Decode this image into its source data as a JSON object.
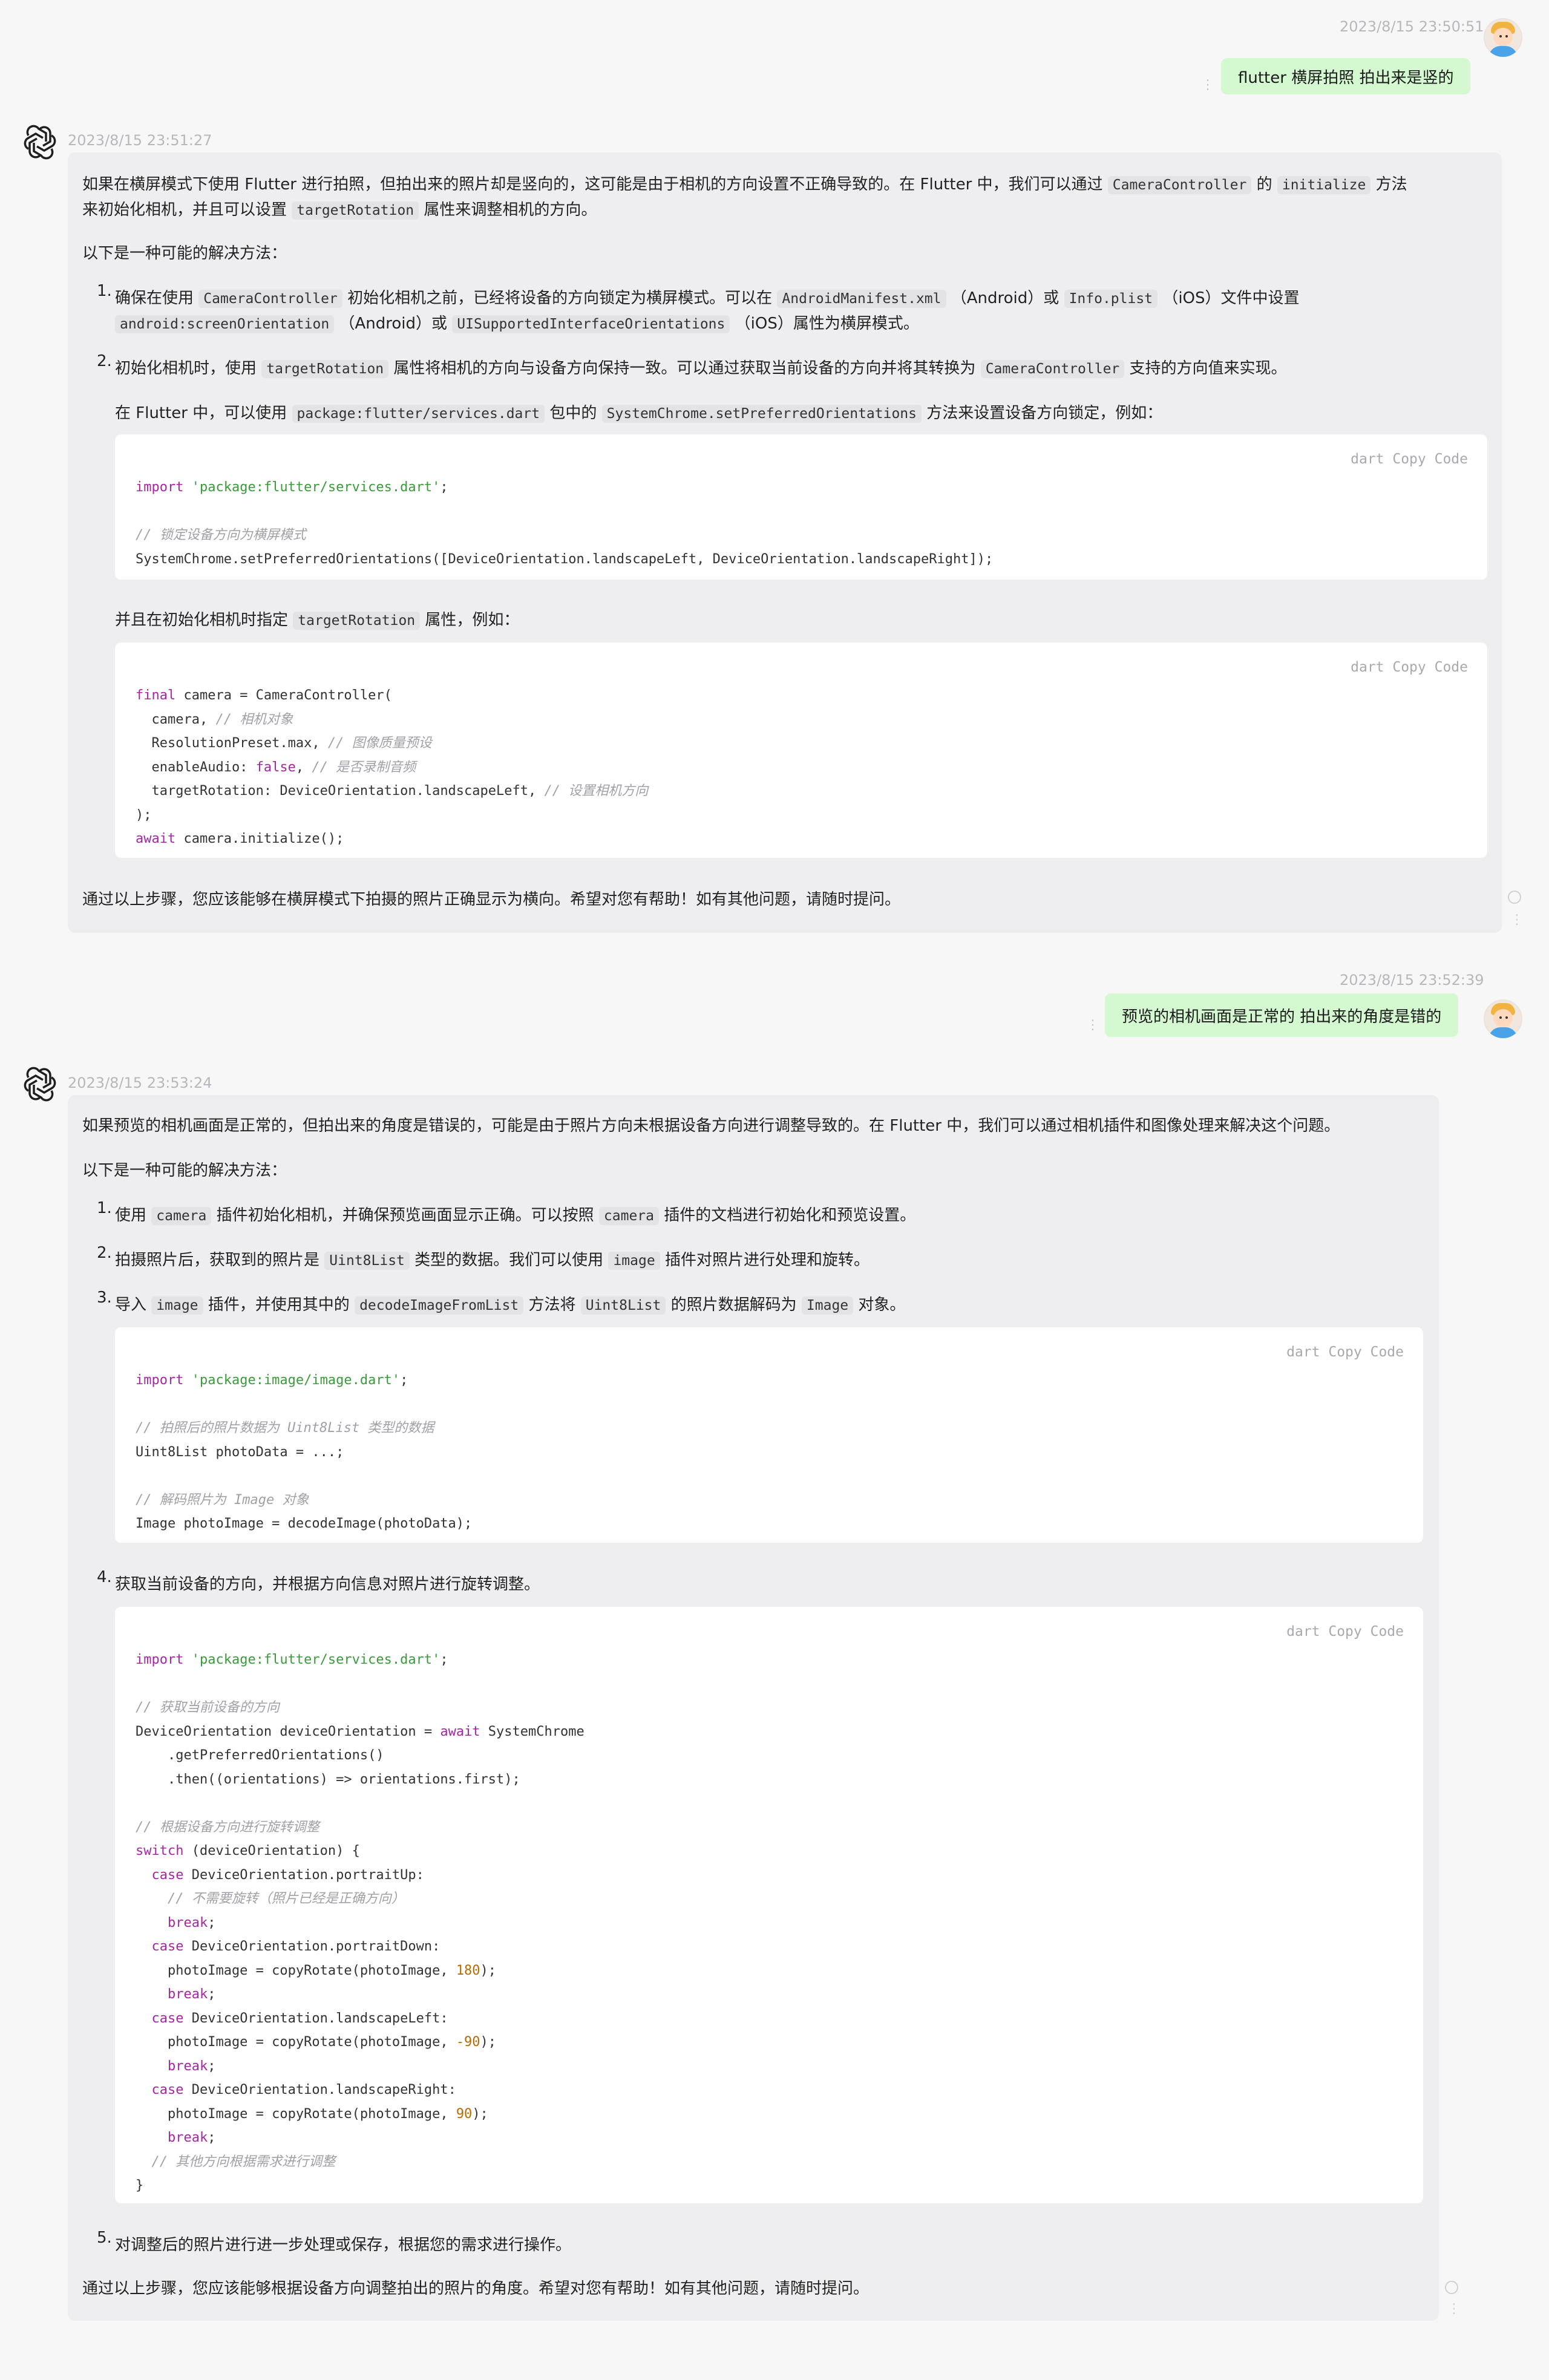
{
  "messages": {
    "m1": {
      "time": "2023/8/15 23:50:51",
      "text": "flutter 横屏拍照 拍出来是竖的"
    },
    "m2": {
      "time": "2023/8/15 23:51:27",
      "intro_a": "如果在横屏模式下使用 Flutter 进行拍照，但拍出来的照片却是竖向的，这可能是由于相机的方向设置不正确导致的。在 Flutter 中，我们可以通过",
      "intro_code1": "CameraController",
      "intro_b": "的",
      "intro_code2": "initialize",
      "intro_c": "方法",
      "intro2_a": "来初始化相机，并且可以设置",
      "intro2_code": "targetRotation",
      "intro2_b": "属性来调整相机的方向。",
      "solutions": "以下是一种可能的解决方法：",
      "s1_a": "确保在使用",
      "s1_code1": "CameraController",
      "s1_b": "初始化相机之前，已经将设备的方向锁定为横屏模式。可以在",
      "s1_code2": "AndroidManifest.xml",
      "s1_c": "（Android）或",
      "s1_code3": "Info.plist",
      "s1_d": "（iOS）文件中设置",
      "s1l2_code1": "android:screenOrientation",
      "s1l2_a": "（Android）或",
      "s1l2_code2": "UISupportedInterfaceOrientations",
      "s1l2_b": "（iOS）属性为横屏模式。",
      "s2_a": "初始化相机时，使用",
      "s2_code1": "targetRotation",
      "s2_b": "属性将相机的方向与设备方向保持一致。可以通过获取当前设备的方向并将其转换为",
      "s2_code2": "CameraController",
      "s2_c": "支持的方向值来实现。",
      "s2p_a": "在 Flutter 中，可以使用",
      "s2p_code1": "package:flutter/services.dart",
      "s2p_b": "包中的",
      "s2p_code2": "SystemChrome.setPreferredOrientations",
      "s2p_c": "方法来设置设备方向锁定，例如：",
      "code_header": "dart Copy Code",
      "s2q_a": "并且在初始化相机时指定",
      "s2q_code": "targetRotation",
      "s2q_b": "属性，例如：",
      "outro": "通过以上步骤，您应该能够在横屏模式下拍摄的照片正确显示为横向。希望对您有帮助！如有其他问题，请随时提问。"
    },
    "m3": {
      "time": "2023/8/15 23:52:39",
      "text": "预览的相机画面是正常的 拍出来的角度是错的"
    },
    "m4": {
      "time": "2023/8/15 23:53:24",
      "intro": "如果预览的相机画面是正常的，但拍出来的角度是错误的，可能是由于照片方向未根据设备方向进行调整导致的。在 Flutter 中，我们可以通过相机插件和图像处理来解决这个问题。",
      "solutions": "以下是一种可能的解决方法：",
      "s1_a": "使用",
      "s1_code1": "camera",
      "s1_b": "插件初始化相机，并确保预览画面显示正确。可以按照",
      "s1_code2": "camera",
      "s1_c": "插件的文档进行初始化和预览设置。",
      "s2_a": "拍摄照片后，获取到的照片是",
      "s2_code1": "Uint8List",
      "s2_b": "类型的数据。我们可以使用",
      "s2_code2": "image",
      "s2_c": "插件对照片进行处理和旋转。",
      "s3_a": "导入",
      "s3_code1": "image",
      "s3_b": "插件，并使用其中的",
      "s3_code2": "decodeImageFromList",
      "s3_c": "方法将",
      "s3_code3": "Uint8List",
      "s3_d": "的照片数据解码为",
      "s3_code4": "Image",
      "s3_e": "对象。",
      "code_header": "dart Copy Code",
      "s4": "获取当前设备的方向，并根据方向信息对照片进行旋转调整。",
      "s5": "对调整后的照片进行进一步处理或保存，根据您的需求进行操作。",
      "outro": "通过以上步骤，您应该能够根据设备方向调整拍出的照片的角度。希望对您有帮助！如有其他问题，请随时提问。"
    }
  },
  "list_numbers": [
    "1.",
    "2.",
    "3.",
    "4.",
    "5."
  ],
  "colors": {
    "user_bubble": "#d4f8d0",
    "assistant_bubble": "#eeeef0",
    "page_bg": "#f7f7f8"
  }
}
